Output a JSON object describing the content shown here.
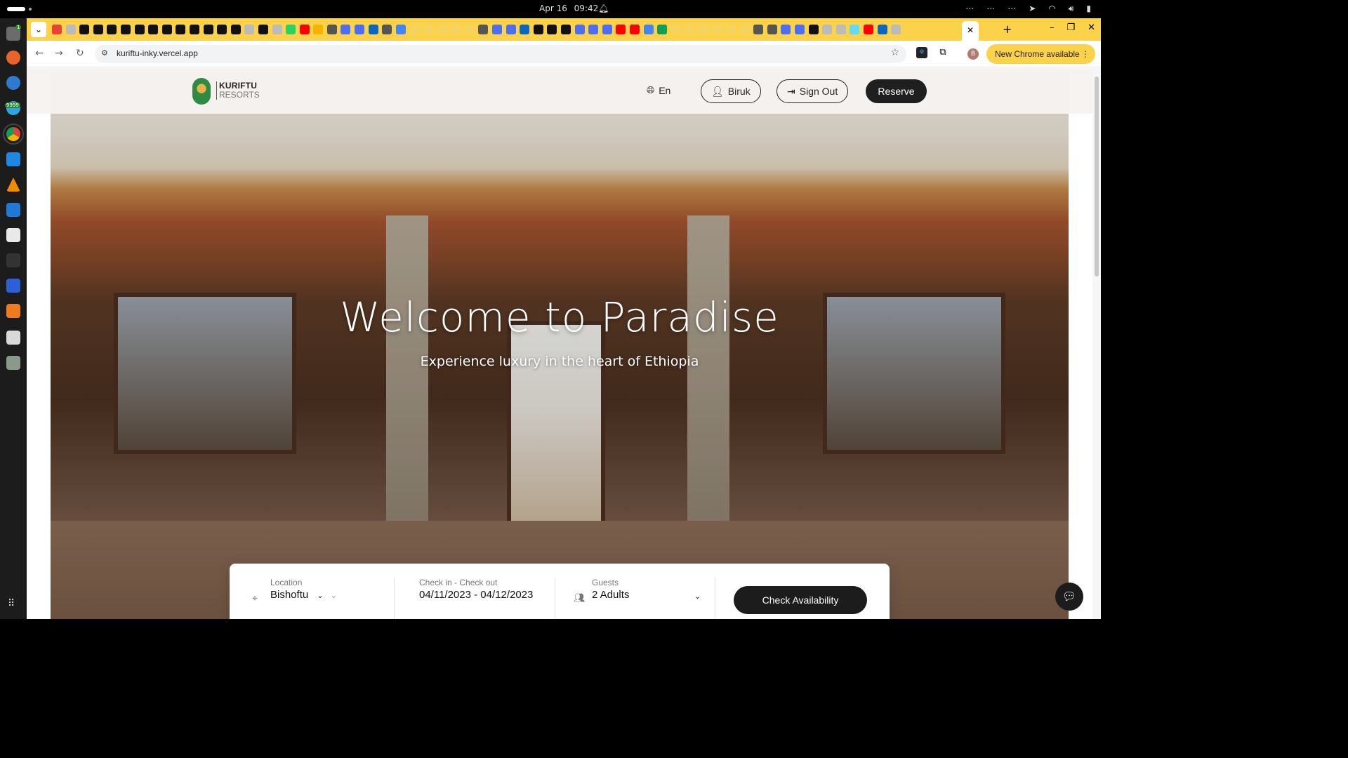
{
  "system": {
    "date": "Apr 16",
    "time": "09:42",
    "tray_icons": [
      "more-icon",
      "more-icon",
      "more-icon",
      "telegram-icon",
      "wifi-icon",
      "volume-icon",
      "battery-icon"
    ]
  },
  "dock": {
    "badge_files": "1",
    "badge_telegram": "9999",
    "apps": [
      "files",
      "firefox",
      "help",
      "telegram",
      "chrome",
      "webstorm",
      "vlc",
      "vscode",
      "libreoffice",
      "terminal",
      "intellij",
      "sublime",
      "screenshot",
      "trash"
    ]
  },
  "browser": {
    "url": "kuriftu-inky.vercel.app",
    "new_chrome_label": "New Chrome available",
    "profile_initial": "B",
    "tab_close": "✕",
    "new_tab": "+"
  },
  "site": {
    "logo_line1": "KURIFTU",
    "logo_line2": "RESORTS",
    "lang_label": "En",
    "user_label": "Biruk",
    "signout_label": "Sign Out",
    "reserve_label": "Reserve",
    "hero_title": "Welcome to Paradise",
    "hero_subtitle": "Experience luxury in the heart of Ethiopia"
  },
  "booking": {
    "location_label": "Location",
    "location_value": "Bishoftu",
    "dates_label": "Check in - Check out",
    "dates_value": "04/11/2023 - 04/12/2023",
    "guests_label": "Guests",
    "guests_value": "2 Adults",
    "check_label": "Check Availability"
  },
  "colors": {
    "tabstrip": "#fbd24a",
    "brand_dark": "#1f1f1f",
    "logo_green": "#2f8a42"
  }
}
